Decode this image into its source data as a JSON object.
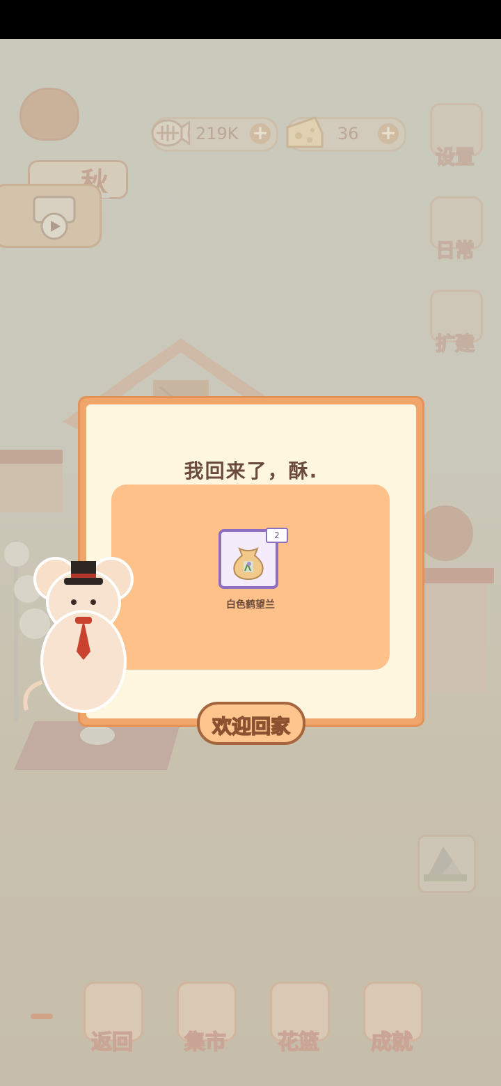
{
  "hud": {
    "season_label": "秋",
    "season_progress": 0,
    "fish_value": "219K",
    "cheese_value": "36"
  },
  "side_buttons": {
    "settings_label": "设置",
    "daily_label": "日常",
    "expand_label": "扩建"
  },
  "dialog": {
    "title": "我回来了，酥.",
    "reward": {
      "item_name": "白色鹤望兰",
      "count": "2"
    },
    "confirm_label": "欢迎回家"
  },
  "bottom_nav": {
    "items": [
      {
        "label": "返回"
      },
      {
        "label": "集市"
      },
      {
        "label": "花篮"
      },
      {
        "label": "成就"
      }
    ]
  },
  "colors": {
    "dialog_border": "#f0a56a",
    "dialog_bg": "#fff6e0",
    "reward_panel": "#ffc18a",
    "item_frame": "#8d6fc1",
    "button_fill": "#ffc58e",
    "button_border": "#a5663e"
  }
}
